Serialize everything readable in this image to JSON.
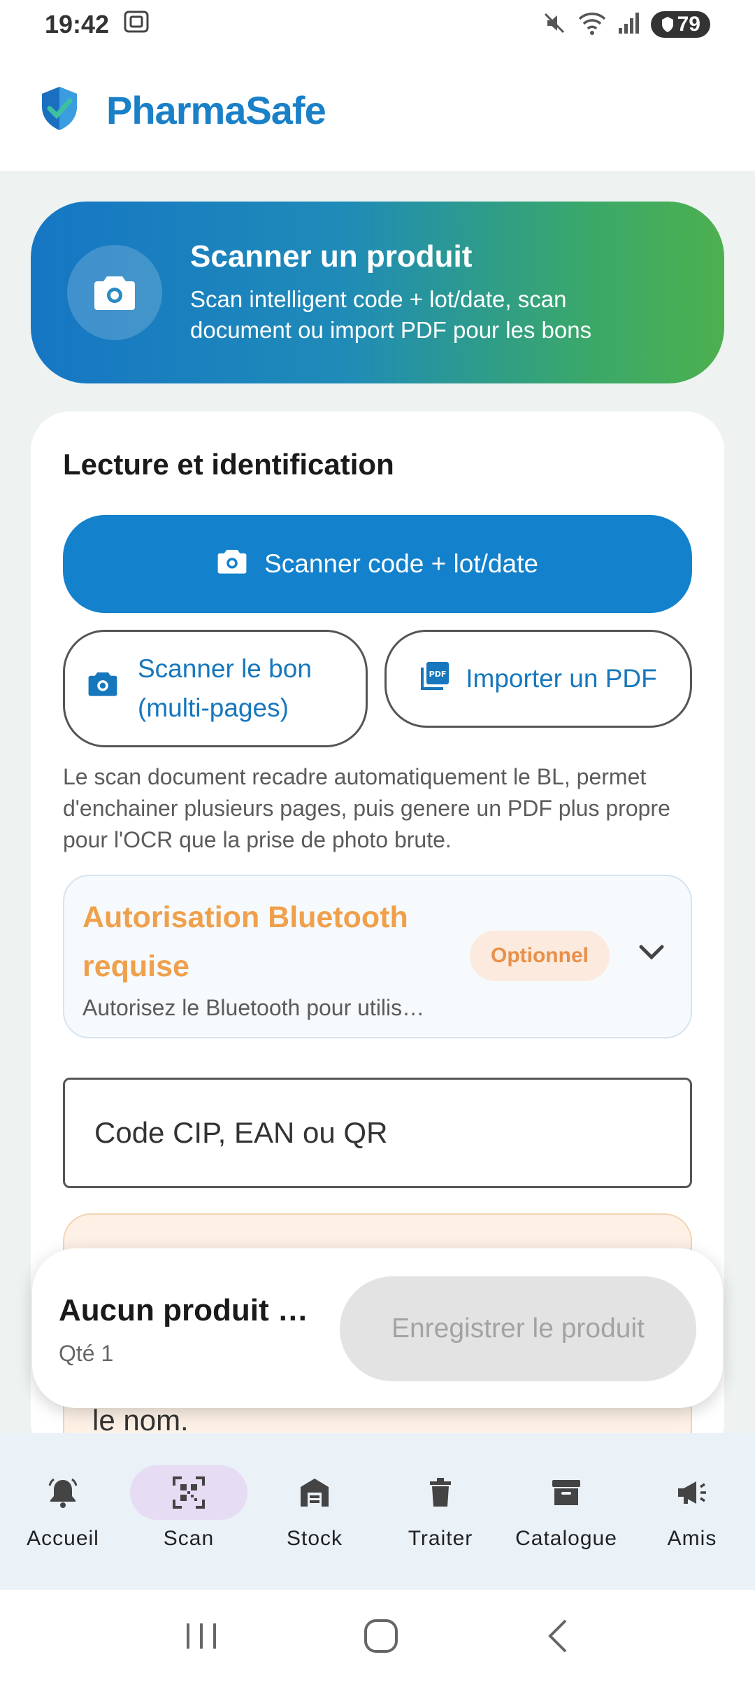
{
  "status_bar": {
    "time": "19:42",
    "battery": "79"
  },
  "header": {
    "app_name": "PharmaSafe",
    "logo_icon": "shield-check-icon"
  },
  "banner": {
    "title": "Scanner un produit",
    "subtitle": "Scan intelligent code + lot/date, scan document ou import PDF pour les bons",
    "icon": "camera-icon"
  },
  "card": {
    "title": "Lecture et identification",
    "primary_button": "Scanner code + lot/date",
    "scan_bon_button": "Scanner le bon (multi-pages)",
    "import_pdf_button": "Importer un PDF",
    "help_text": "Le scan document recadre automatiquement le BL, permet d'enchainer plusieurs pages, puis genere un PDF plus propre pour l'OCR que la prise de photo brute.",
    "bluetooth": {
      "title": "Autorisation Bluetooth requise",
      "subtitle": "Autorisez le Bluetooth pour utilis…",
      "badge": "Optionnel"
    },
    "code_input_placeholder": "Code CIP, EAN ou QR",
    "warning_partial_text": "le nom."
  },
  "floating": {
    "title": "Aucun produit …",
    "qty": "Qté 1",
    "save_button": "Enregistrer le produit"
  },
  "nav": [
    {
      "label": "Accueil",
      "icon": "bell-icon"
    },
    {
      "label": "Scan",
      "icon": "qr-code-icon"
    },
    {
      "label": "Stock",
      "icon": "warehouse-icon"
    },
    {
      "label": "Traiter",
      "icon": "trash-icon"
    },
    {
      "label": "Catalogue",
      "icon": "archive-box-icon"
    },
    {
      "label": "Amis",
      "icon": "megaphone-icon"
    }
  ],
  "colors": {
    "primary": "#1381cc",
    "brand_text": "#1a80c8",
    "warning": "#f0a04b",
    "nav_active": "#e6dcf4"
  }
}
